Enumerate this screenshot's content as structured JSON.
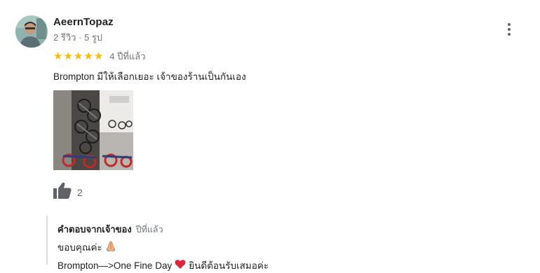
{
  "review": {
    "author_name": "AeernTopaz",
    "author_meta": "2 รีวิว · 5 รูป",
    "rating": 5,
    "time": "4 ปีที่แล้ว",
    "text": "Brompton มีให้เลือกเยอะ เจ้าของร้านเป็นกันเอง",
    "like_count": "2"
  },
  "icons": {
    "more": "more-vert-icon",
    "like": "thumb-up-icon",
    "star": "star-icon",
    "pray": "folded-hands-emoji",
    "heart": "red-heart-emoji"
  },
  "owner_reply": {
    "title": "คำตอบจากเจ้าของ",
    "time": "ปีที่แล้ว",
    "line1": "ขอบคุณค่ะ",
    "line2_start": "Brompton—>One Fine Day",
    "line2_end": "ยินดีต้อนรับเสมอค่ะ"
  },
  "colors": {
    "star": "#fbbc04",
    "secondary_text": "#70757a",
    "heart": "#e0243a"
  }
}
